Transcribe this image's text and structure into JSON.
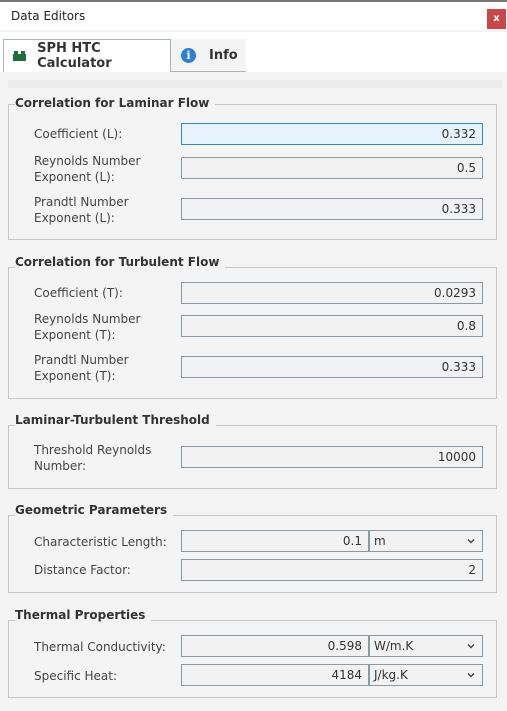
{
  "window": {
    "title": "Data Editors",
    "close_label": "x"
  },
  "tabs": [
    {
      "label": "SPH HTC Calculator",
      "icon": "lego-block-icon",
      "active": true
    },
    {
      "label": "Info",
      "icon": "info-icon",
      "active": false
    }
  ],
  "groups": {
    "laminar": {
      "title": "Correlation for Laminar Flow",
      "fields": [
        {
          "label_lines": [
            "Coefficient (L):"
          ],
          "value": "0.332",
          "focused": true
        },
        {
          "label_lines": [
            "Reynolds Number",
            "Exponent (L):"
          ],
          "value": "0.5"
        },
        {
          "label_lines": [
            "Prandtl Number",
            "Exponent (L):"
          ],
          "value": "0.333"
        }
      ]
    },
    "turbulent": {
      "title": "Correlation for Turbulent Flow",
      "fields": [
        {
          "label_lines": [
            "Coefficient (T):"
          ],
          "value": "0.0293"
        },
        {
          "label_lines": [
            "Reynolds Number",
            "Exponent (T):"
          ],
          "value": "0.8"
        },
        {
          "label_lines": [
            "Prandtl Number",
            "Exponent (T):"
          ],
          "value": "0.333"
        }
      ]
    },
    "threshold": {
      "title": "Laminar-Turbulent Threshold",
      "fields": [
        {
          "label_lines": [
            "Threshold Reynolds",
            "Number:"
          ],
          "value": "10000"
        }
      ]
    },
    "geometric": {
      "title": "Geometric Parameters",
      "fields": [
        {
          "label_lines": [
            "Characteristic Length:"
          ],
          "value": "0.1",
          "unit": "m"
        },
        {
          "label_lines": [
            "Distance Factor:"
          ],
          "value": "2"
        }
      ]
    },
    "thermal": {
      "title": "Thermal Properties",
      "fields": [
        {
          "label_lines": [
            "Thermal Conductivity:"
          ],
          "value": "0.598",
          "unit": "W/m.K"
        },
        {
          "label_lines": [
            "Specific Heat:"
          ],
          "value": "4184",
          "unit": "J/kg.K"
        }
      ]
    }
  },
  "colors": {
    "close_button": "#c9474a",
    "focus_border": "#2c8cd1",
    "focus_bg": "#e6f3fc",
    "tab_icon_green": "#1f6f3a",
    "info_blue": "#2d7fd6"
  }
}
